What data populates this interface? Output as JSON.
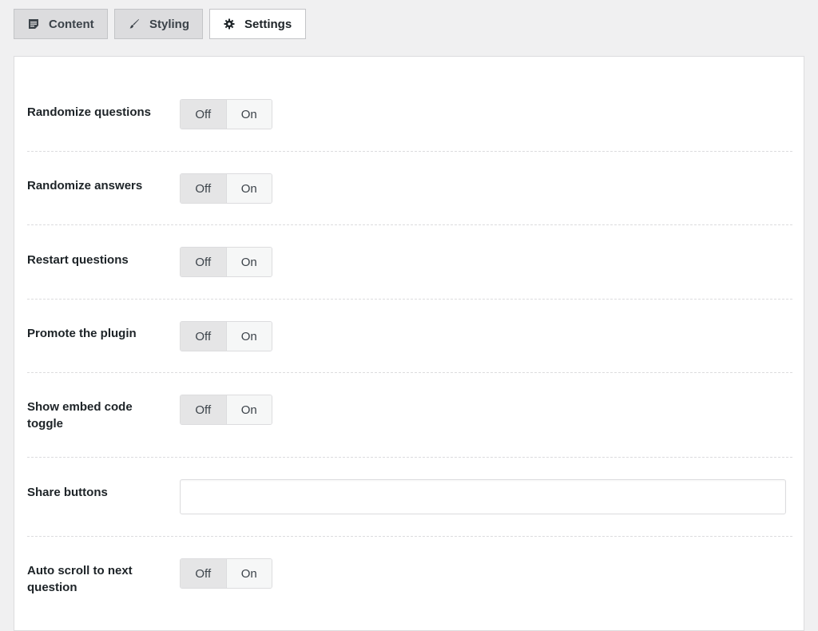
{
  "tabs": [
    {
      "label": "Content",
      "icon": "document-icon",
      "active": false
    },
    {
      "label": "Styling",
      "icon": "brush-icon",
      "active": false
    },
    {
      "label": "Settings",
      "icon": "gear-icon",
      "active": true
    }
  ],
  "settings": {
    "randomize_questions": {
      "label": "Randomize questions",
      "off": "Off",
      "on": "On",
      "selected": "Off"
    },
    "randomize_answers": {
      "label": "Randomize answers",
      "off": "Off",
      "on": "On",
      "selected": "Off"
    },
    "restart_questions": {
      "label": "Restart questions",
      "off": "Off",
      "on": "On",
      "selected": "Off"
    },
    "promote_plugin": {
      "label": "Promote the plugin",
      "off": "Off",
      "on": "On",
      "selected": "Off"
    },
    "show_embed_code_toggle": {
      "label": "Show embed code toggle",
      "off": "Off",
      "on": "On",
      "selected": "Off"
    },
    "share_buttons": {
      "label": "Share buttons",
      "value": ""
    },
    "auto_scroll": {
      "label": "Auto scroll to next question",
      "off": "Off",
      "on": "On",
      "selected": "Off"
    }
  },
  "colors": {
    "background": "#f0f0f1",
    "panel": "#ffffff",
    "tab_inactive": "#dcdcde",
    "toggle_selected": "#e5e5e6"
  }
}
